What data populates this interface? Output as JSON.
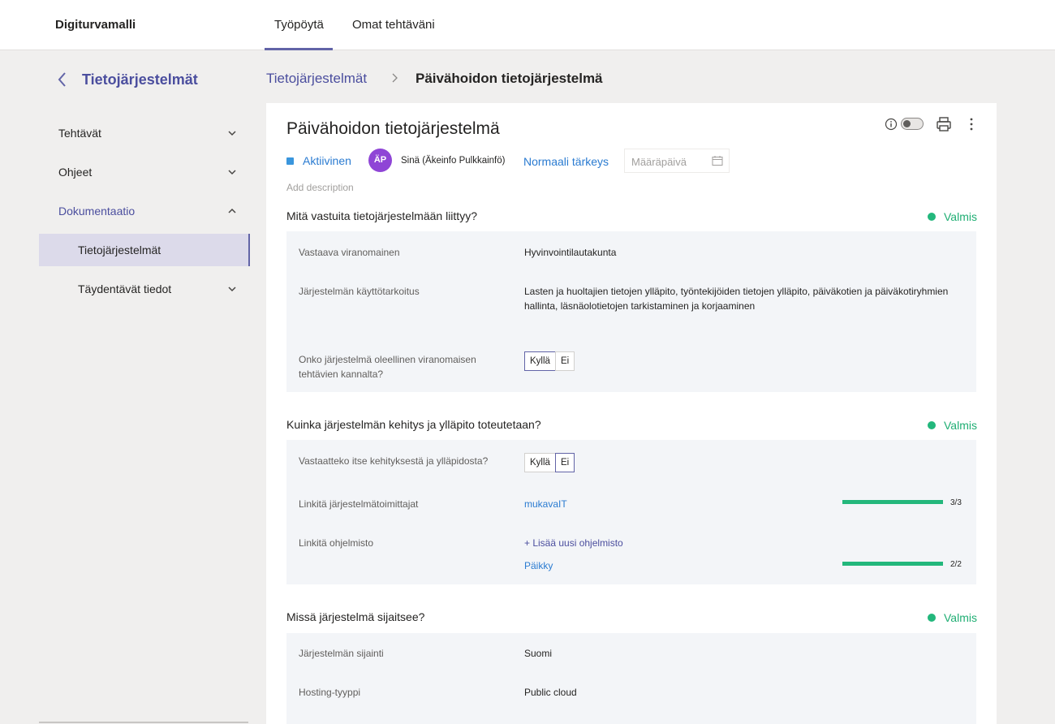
{
  "header": {
    "app_title": "Digiturvamalli",
    "tabs": [
      {
        "label": "Työpöytä",
        "active": true
      },
      {
        "label": "Omat tehtäväni",
        "active": false
      }
    ],
    "accent_color": "#6264a7"
  },
  "sidebar": {
    "title": "Tietojärjestelmät",
    "items": [
      {
        "label": "Tehtävät",
        "chevron": "chevron-down-icon"
      },
      {
        "label": "Ohjeet",
        "chevron": "chevron-down-icon"
      },
      {
        "label": "Dokumentaatio",
        "chevron": "chevron-up-icon"
      },
      {
        "label": "Tietojärjestelmät",
        "selected": true
      },
      {
        "label": "Täydentävät tiedot",
        "chevron": "chevron-down-icon"
      }
    ]
  },
  "breadcrumb": {
    "parent": "Tietojärjestelmät",
    "current": "Päivähoidon tietojärjestelmä"
  },
  "task": {
    "title": "Päivähoidon tietojärjestelmä",
    "status": "Aktiivinen",
    "status_color": "#3a96dd",
    "avatar_initials": "ÄP",
    "avatar_color": "#8f45d6",
    "assignee": "Sinä (Äkeinfo Pulkkainfö)",
    "priority": "Normaali tärkeys",
    "due_placeholder": "Määräpäivä",
    "add_description": "Add description"
  },
  "sections": [
    {
      "title": "Mitä vastuita tietojärjestelmään liittyy?",
      "status": "Valmis",
      "fields": {
        "authority_label": "Vastaava viranomainen",
        "authority_value": "Hyvinvointilautakunta",
        "purpose_label": "Järjestelmän käyttötarkoitus",
        "purpose_value": "Lasten ja huoltajien tietojen ylläpito, työntekijöiden tietojen ylläpito, päiväkotien ja päiväkotiryhmien hallinta, läsnäolotietojen tarkistaminen ja korjaaminen",
        "essential_label": "Onko järjestelmä oleellinen viranomaisen tehtävien kannalta?",
        "essential_options": [
          "Kyllä",
          "Ei"
        ],
        "essential_selected": "Kyllä"
      }
    },
    {
      "title": "Kuinka järjestelmän kehitys ja ylläpito toteutetaan?",
      "status": "Valmis",
      "fields": {
        "responsible_label": "Vastaatteko itse kehityksestä ja ylläpidosta?",
        "responsible_options": [
          "Kyllä",
          "Ei"
        ],
        "responsible_selected": "Ei",
        "vendors_label": "Linkitä järjestelmätoimittajat",
        "vendor_name": "mukavaIT",
        "vendor_progress_text": "3/3",
        "vendor_progress": 1.0,
        "software_label": "Linkitä ohjelmisto",
        "software_add": "+ Lisää uusi ohjelmisto",
        "software_name": "Päikky",
        "software_progress_text": "2/2",
        "software_progress": 1.0
      }
    },
    {
      "title": "Missä järjestelmä sijaitsee?",
      "status": "Valmis",
      "fields": {
        "location_label": "Järjestelmän sijainti",
        "location_value": "Suomi",
        "hosting_label": "Hosting-tyyppi",
        "hosting_value": "Public cloud"
      }
    }
  ],
  "status_done_color": "#23b77c"
}
